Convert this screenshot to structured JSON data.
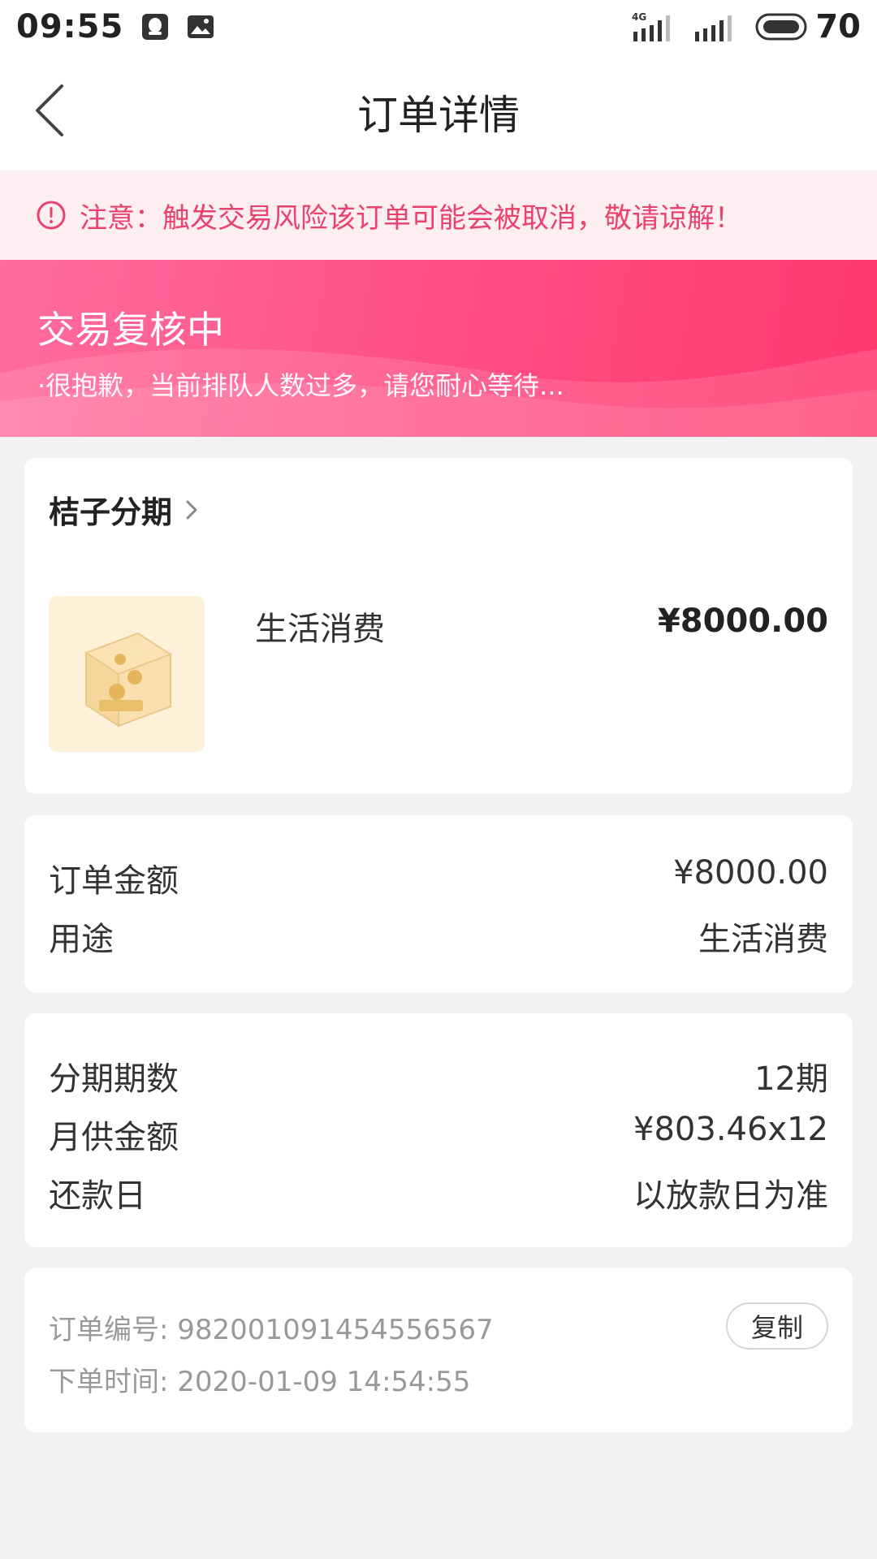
{
  "status_bar": {
    "time": "09:55",
    "battery": "70",
    "network": "4G"
  },
  "nav": {
    "title": "订单详情"
  },
  "warning": {
    "text": "注意：触发交易风险该订单可能会被取消，敬请谅解！",
    "color": "#e8426d"
  },
  "banner": {
    "title": "交易复核中",
    "subtitle": "·很抱歉，当前排队人数过多，请您耐心等待..."
  },
  "product": {
    "merchant": "桔子分期",
    "use": "生活消费",
    "price": "¥8000.00"
  },
  "summary": {
    "rows": [
      {
        "label": "订单金额",
        "value": "¥8000.00"
      },
      {
        "label": "用途",
        "value": "生活消费"
      }
    ]
  },
  "plan": {
    "rows": [
      {
        "label": "分期期数",
        "value": "12期"
      },
      {
        "label": "月供金额",
        "value": "¥803.46x12"
      },
      {
        "label": "还款日",
        "value": "以放款日为准"
      }
    ]
  },
  "meta": {
    "order_no_label": "订单编号:",
    "order_no": "982001091454556567",
    "time_label": "下单时间:",
    "time": "2020-01-09 14:54:55",
    "copy_label": "复制"
  }
}
